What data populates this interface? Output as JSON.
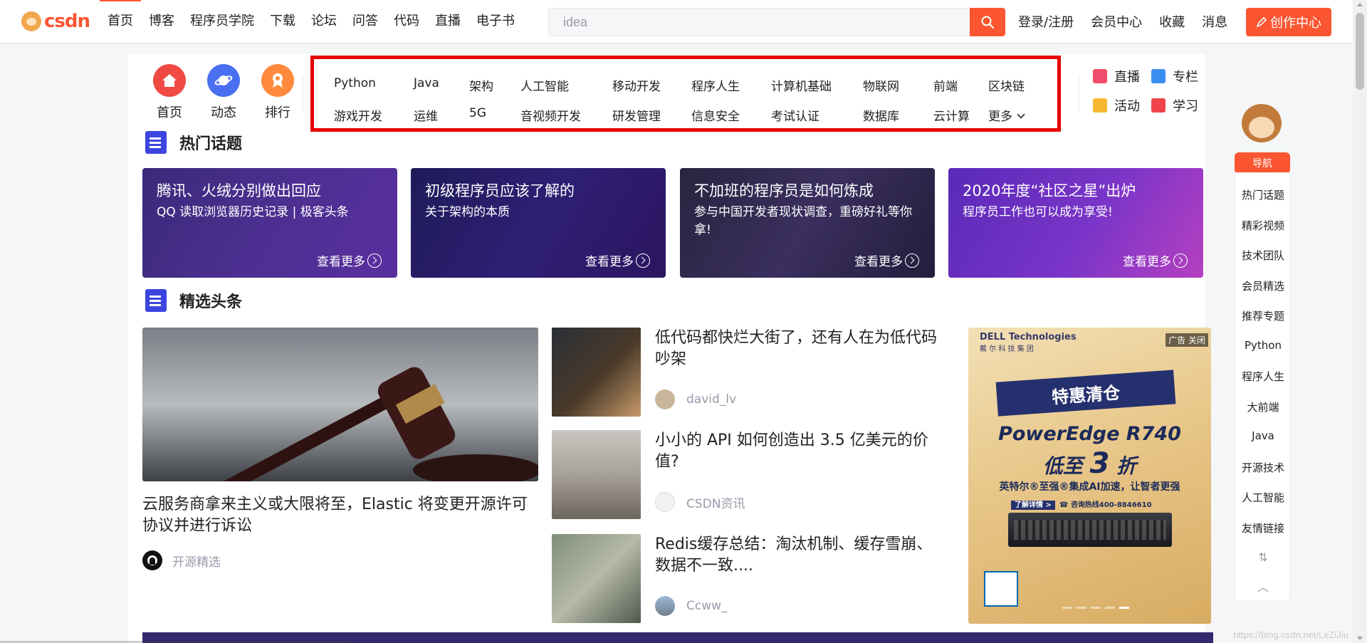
{
  "topnav": {
    "logo_text": "csdn",
    "items": [
      "首页",
      "博客",
      "程序员学院",
      "下载",
      "论坛",
      "问答",
      "代码",
      "直播",
      "电子书"
    ],
    "search_value": "idea",
    "right": [
      "登录/注册",
      "会员中心",
      "收藏",
      "消息"
    ],
    "create_label": "创作中心"
  },
  "quick": [
    {
      "label": "首页",
      "color": "#f14a43"
    },
    {
      "label": "动态",
      "color": "#4a6ff0"
    },
    {
      "label": "排行",
      "color": "#ff8a3d"
    }
  ],
  "categories": {
    "row1": [
      "Python",
      "Java",
      "架构",
      "人工智能",
      "移动开发",
      "程序人生",
      "计算机基础",
      "物联网",
      "前端",
      "区块链"
    ],
    "row2": [
      "游戏开发",
      "运维",
      "5G",
      "音视频开发",
      "研发管理",
      "信息安全",
      "考试认证",
      "数据库",
      "云计算",
      "更多"
    ]
  },
  "right_links": [
    {
      "label": "直播",
      "color": "#f24d6e"
    },
    {
      "label": "专栏",
      "color": "#3b8ef0"
    },
    {
      "label": "活动",
      "color": "#f7b731"
    },
    {
      "label": "学习",
      "color": "#f0444c"
    }
  ],
  "hot_topics": {
    "heading": "热门话题",
    "more_label": "查看更多",
    "items": [
      {
        "title": "腾讯、火绒分别做出回应",
        "sub": "QQ 读取浏览器历史记录 | 极客头条"
      },
      {
        "title": "初级程序员应该了解的",
        "sub": "关于架构的本质"
      },
      {
        "title": "不加班的程序员是如何炼成",
        "sub": "参与中国开发者现状调查，重磅好礼等你拿!"
      },
      {
        "title": "2020年度“社区之星”出炉",
        "sub": "程序员工作也可以成为享受!"
      }
    ]
  },
  "headlines": {
    "heading": "精选头条",
    "feature": {
      "title": "云服务商拿来主义或大限将至，Elastic 将变更开源许可协议并进行诉讼",
      "author": "开源精选"
    },
    "news": [
      {
        "title": "低代码都快烂大街了，还有人在为低代码吵架",
        "author": "david_lv"
      },
      {
        "title": "小小的 API 如何创造出 3.5 亿美元的价值?",
        "author": "CSDN资讯"
      },
      {
        "title": "Redis缓存总结：淘汰机制、缓存雪崩、数据不一致....",
        "author": "Ccww_"
      }
    ]
  },
  "ad": {
    "brand": "DELL Technologies",
    "brand_sub": "戴 尔 科 技 集 团",
    "tag": "广告 关闭",
    "ribbon": "特惠清仓",
    "line1": "PowerEdge R740",
    "line2_a": "低至",
    "line2_b": "3",
    "line2_c": "折",
    "line3": "英特尔®至强®集成AI加速，让智者更强",
    "line4_btn": "了解详情 >",
    "line4_tel": "☎ 咨询热线400-8846610"
  },
  "side": {
    "nav_label": "导航",
    "items": [
      "热门话题",
      "精彩视频",
      "技术团队",
      "会员精选",
      "推荐专题",
      "Python",
      "程序人生",
      "大前端",
      "Java",
      "开源技术",
      "人工智能",
      "友情链接"
    ]
  },
  "watermark": "https://blog.csdn.net/LeZiJiu"
}
